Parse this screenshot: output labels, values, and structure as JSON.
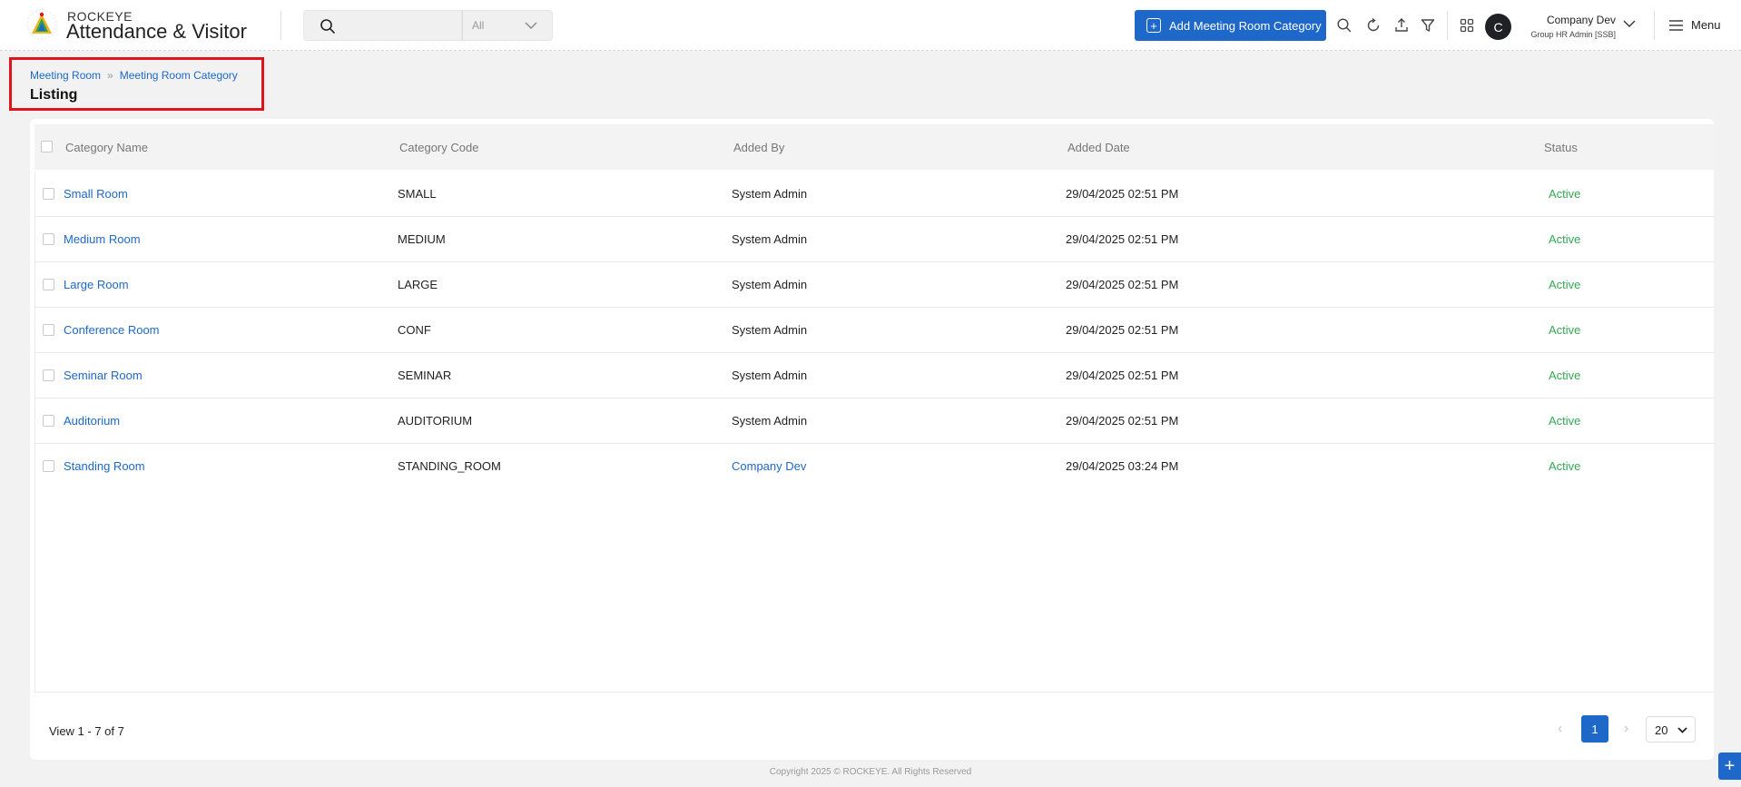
{
  "brand": {
    "small": "ROCKEYE",
    "big": "Attendance & Visitor"
  },
  "search": {
    "placeholder": "",
    "scope": "All"
  },
  "header": {
    "add_button": "Add Meeting Room Category",
    "user_name": "Company Dev",
    "user_role": "Group HR Admin [SSB]",
    "avatar_letter": "C",
    "menu_label": "Menu"
  },
  "breadcrumb": {
    "items": [
      "Meeting Room",
      "Meeting Room Category"
    ],
    "title": "Listing"
  },
  "table": {
    "headers": [
      "Category Name",
      "Category Code",
      "Added By",
      "Added Date",
      "Status"
    ],
    "rows": [
      {
        "name": "Small Room",
        "code": "SMALL",
        "added_by": "System Admin",
        "added_date": "29/04/2025 02:51 PM",
        "status": "Active"
      },
      {
        "name": "Medium Room",
        "code": "MEDIUM",
        "added_by": "System Admin",
        "added_date": "29/04/2025 02:51 PM",
        "status": "Active"
      },
      {
        "name": "Large Room",
        "code": "LARGE",
        "added_by": "System Admin",
        "added_date": "29/04/2025 02:51 PM",
        "status": "Active"
      },
      {
        "name": "Conference Room",
        "code": "CONF",
        "added_by": "System Admin",
        "added_date": "29/04/2025 02:51 PM",
        "status": "Active"
      },
      {
        "name": "Seminar Room",
        "code": "SEMINAR",
        "added_by": "System Admin",
        "added_date": "29/04/2025 02:51 PM",
        "status": "Active"
      },
      {
        "name": "Auditorium",
        "code": "AUDITORIUM",
        "added_by": "System Admin",
        "added_date": "29/04/2025 02:51 PM",
        "status": "Active"
      },
      {
        "name": "Standing Room",
        "code": "STANDING_ROOM",
        "added_by": "Company Dev",
        "added_date": "29/04/2025 03:24 PM",
        "status": "Active"
      }
    ]
  },
  "pagination": {
    "view_text": "View 1 - 7 of 7",
    "current_page": "1",
    "page_size": "20"
  },
  "footer": {
    "copyright": "Copyright 2025 © ROCKEYE. All Rights Reserved"
  },
  "colors": {
    "accent": "#1d68c9",
    "status_active": "#34a853",
    "highlight": "#e0151b"
  },
  "icons": [
    "logo-icon",
    "search-icon",
    "chevron-down-icon",
    "plus-icon",
    "refresh-icon",
    "upload-icon",
    "filter-icon",
    "apps-grid-icon",
    "hamburger-icon"
  ]
}
